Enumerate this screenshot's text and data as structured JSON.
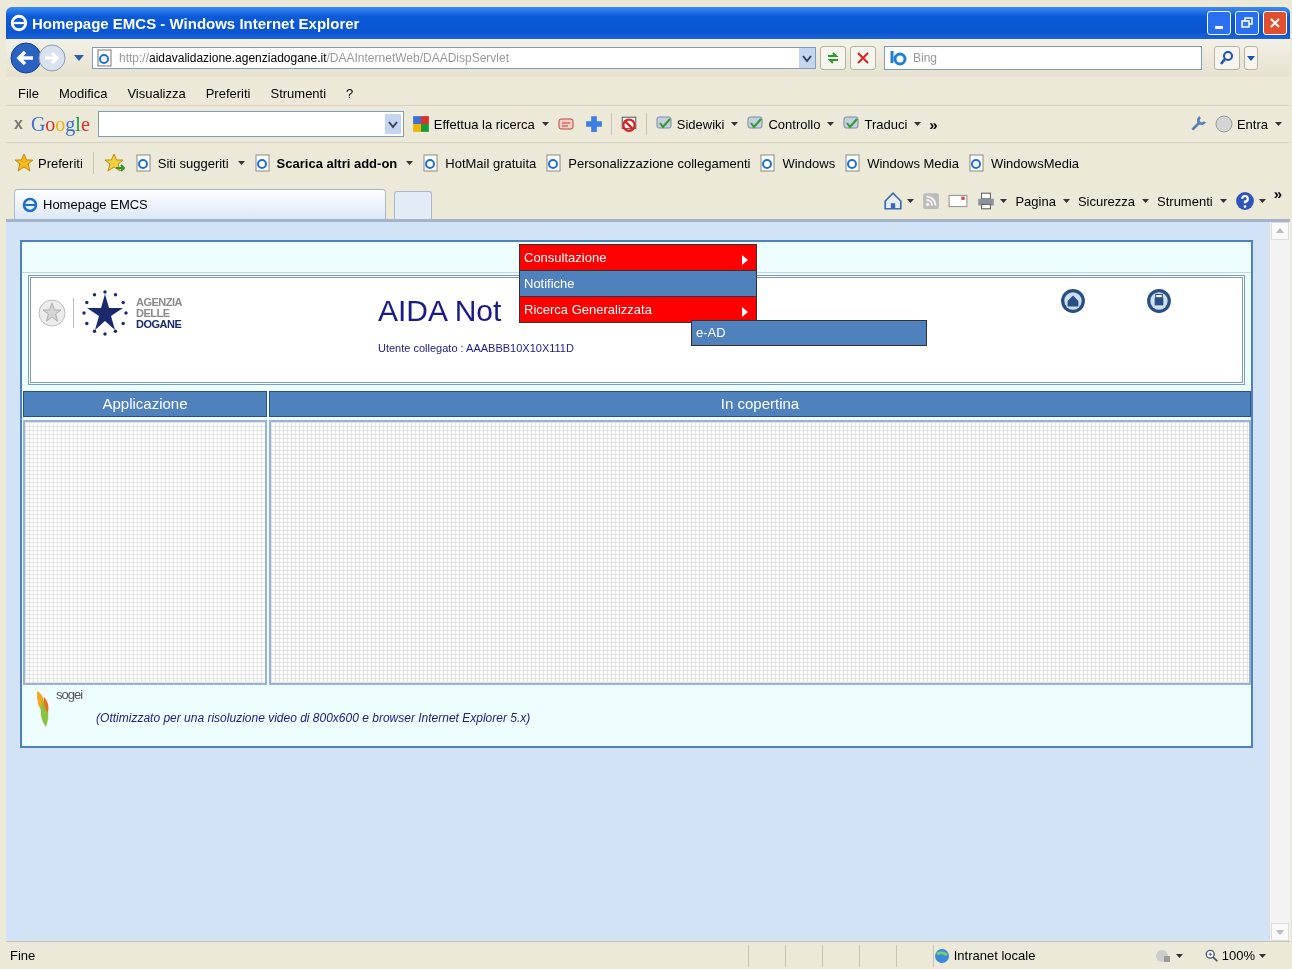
{
  "window": {
    "title": "Homepage EMCS - Windows Internet Explorer"
  },
  "address_bar": {
    "scheme": "http://",
    "host": "aidavalidazione.agenziadogane.it",
    "path": "/DAAInternetWeb/DAADispServlet"
  },
  "search_box": {
    "placeholder": "Bing"
  },
  "menu_bar": [
    "File",
    "Modifica",
    "Visualizza",
    "Preferiti",
    "Strumenti",
    "?"
  ],
  "google_toolbar": {
    "close": "x",
    "logo": "Google",
    "search_button": "Effettua la ricerca",
    "items": [
      {
        "label": "Sidewiki"
      },
      {
        "label": "Controllo"
      },
      {
        "label": "Traduci"
      }
    ],
    "more": "»",
    "sign_in": "Entra"
  },
  "favorites_bar": {
    "label": "Preferiti",
    "items": [
      {
        "label": "Siti suggeriti",
        "bold": false,
        "dropdown": true
      },
      {
        "label": "Scarica altri add-on",
        "bold": true,
        "dropdown": true
      },
      {
        "label": "HotMail gratuita",
        "bold": false,
        "dropdown": false
      },
      {
        "label": "Personalizzazione collegamenti",
        "bold": false,
        "dropdown": false
      },
      {
        "label": "Windows",
        "bold": false,
        "dropdown": false
      },
      {
        "label": "Windows Media",
        "bold": false,
        "dropdown": false
      },
      {
        "label": "WindowsMedia",
        "bold": false,
        "dropdown": false
      }
    ]
  },
  "tabs": [
    {
      "label": "Homepage EMCS",
      "selected": true
    }
  ],
  "command_bar": {
    "items": [
      "Pagina",
      "Sicurezza",
      "Strumenti"
    ],
    "more": "»"
  },
  "page": {
    "logo_text": [
      "AGENZIA",
      "DELLE",
      "DOGANE"
    ],
    "title": "AIDA Not",
    "user_label": "Utente collegato :",
    "user_id": "AAABBB10X10X111D",
    "menu": [
      {
        "label": "Consultazione",
        "color": "#ff0000",
        "submenu": true
      },
      {
        "label": "Notifiche",
        "color": "#4f81bd",
        "submenu": false
      },
      {
        "label": "Ricerca Generalizzata",
        "color": "#ff0000",
        "submenu": true
      }
    ],
    "submenu": [
      {
        "label": "e-AD"
      }
    ],
    "columns": [
      {
        "label": "Applicazione"
      },
      {
        "label": "In copertina"
      }
    ],
    "footer_logo": "sogei",
    "footer_note": "(Ottimizzato per una risoluzione video di 800x600 e browser Internet Explorer 5.x)"
  },
  "status_bar": {
    "text": "Fine",
    "zone": "Intranet locale",
    "zoom": "100%"
  }
}
